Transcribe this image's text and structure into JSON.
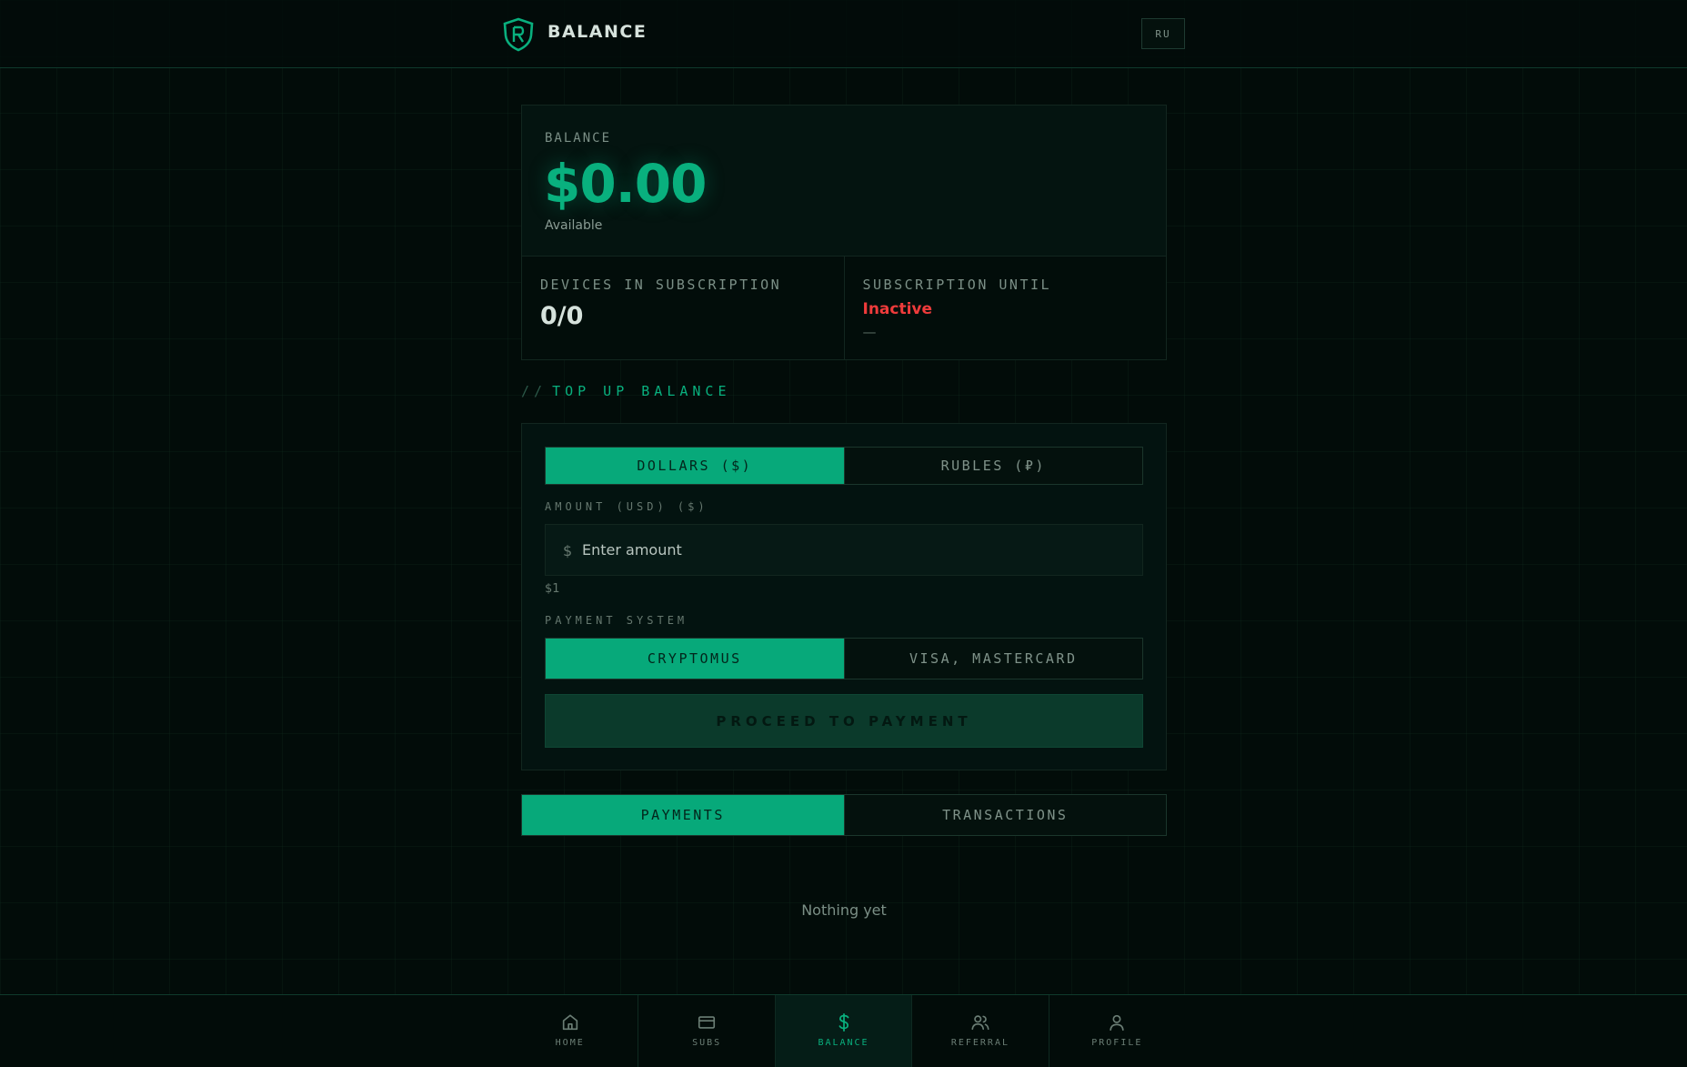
{
  "header": {
    "brand": "BALANCE",
    "lang_button": "RU",
    "logo_letter": "R"
  },
  "balance": {
    "label": "BALANCE",
    "amount": "$0.00",
    "available": "Available"
  },
  "stats": {
    "devices_label": "DEVICES IN SUBSCRIPTION",
    "devices_value": "0/0",
    "until_label": "SUBSCRIPTION UNTIL",
    "until_status": "Inactive",
    "until_date": "—"
  },
  "topup": {
    "section_prefix": "//",
    "section_title": "TOP UP BALANCE",
    "currency_tabs": [
      {
        "label": "DOLLARS ($)",
        "active": true
      },
      {
        "label": "RUBLES (₽)",
        "active": false
      }
    ],
    "amount_label": "AMOUNT (USD) ($)",
    "amount_currency_symbol": "$",
    "amount_placeholder": "Enter amount",
    "amount_value": "",
    "min_note": "$1",
    "payment_system_label": "PAYMENT SYSTEM",
    "payment_tabs": [
      {
        "label": "CRYPTOMUS",
        "active": true
      },
      {
        "label": "VISA, MASTERCARD",
        "active": false
      }
    ],
    "proceed_button": "PROCEED TO PAYMENT"
  },
  "history": {
    "tabs": [
      {
        "label": "PAYMENTS",
        "active": true
      },
      {
        "label": "TRANSACTIONS",
        "active": false
      }
    ],
    "empty_text": "Nothing yet"
  },
  "bottom_nav": {
    "items": [
      {
        "label": "HOME",
        "icon": "home-icon",
        "active": false
      },
      {
        "label": "SUBS",
        "icon": "card-icon",
        "active": false
      },
      {
        "label": "BALANCE",
        "icon": "dollar-icon",
        "active": true
      },
      {
        "label": "REFERRAL",
        "icon": "users-icon",
        "active": false
      },
      {
        "label": "PROFILE",
        "icon": "user-icon",
        "active": false
      }
    ]
  },
  "colors": {
    "accent": "#09b07e",
    "background": "#020c09",
    "inactive_status": "#ef3b3b"
  }
}
